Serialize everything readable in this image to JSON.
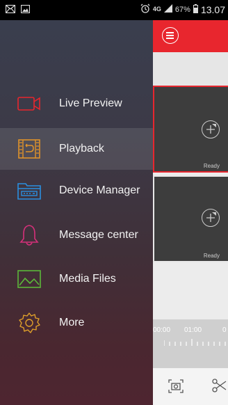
{
  "status_bar": {
    "left_icons": [
      "mail-icon",
      "image-icon"
    ],
    "alarm_icon": "alarm-clock-icon",
    "network": "4G",
    "signal_icon": "signal-icon",
    "battery": "67%",
    "time": "13.07"
  },
  "drawer": {
    "items": [
      {
        "label": "Live Preview",
        "icon": "camera-icon",
        "color": "#e8262e"
      },
      {
        "label": "Playback",
        "icon": "playback-film-icon",
        "color": "#e0932a",
        "active": true
      },
      {
        "label": "Device Manager",
        "icon": "folder-device-icon",
        "color": "#2a8fe0"
      },
      {
        "label": "Message center",
        "icon": "bell-icon",
        "color": "#d6307a"
      },
      {
        "label": "Media Files",
        "icon": "image-icon",
        "color": "#5cb83a"
      },
      {
        "label": "More",
        "icon": "gear-icon",
        "color": "#e0a02a"
      }
    ]
  },
  "main": {
    "topbar_color": "#e8262e",
    "menu_icon": "hamburger-menu-icon",
    "panes": [
      {
        "status": "Ready",
        "icon": "add-camera-icon"
      },
      {
        "status": "Ready",
        "icon": "add-camera-icon"
      }
    ],
    "timeline": {
      "labels": [
        "00:00",
        "01:00",
        "0"
      ]
    },
    "bottom_icons": [
      "screenshot-camera-icon",
      "scissors-icon"
    ]
  }
}
